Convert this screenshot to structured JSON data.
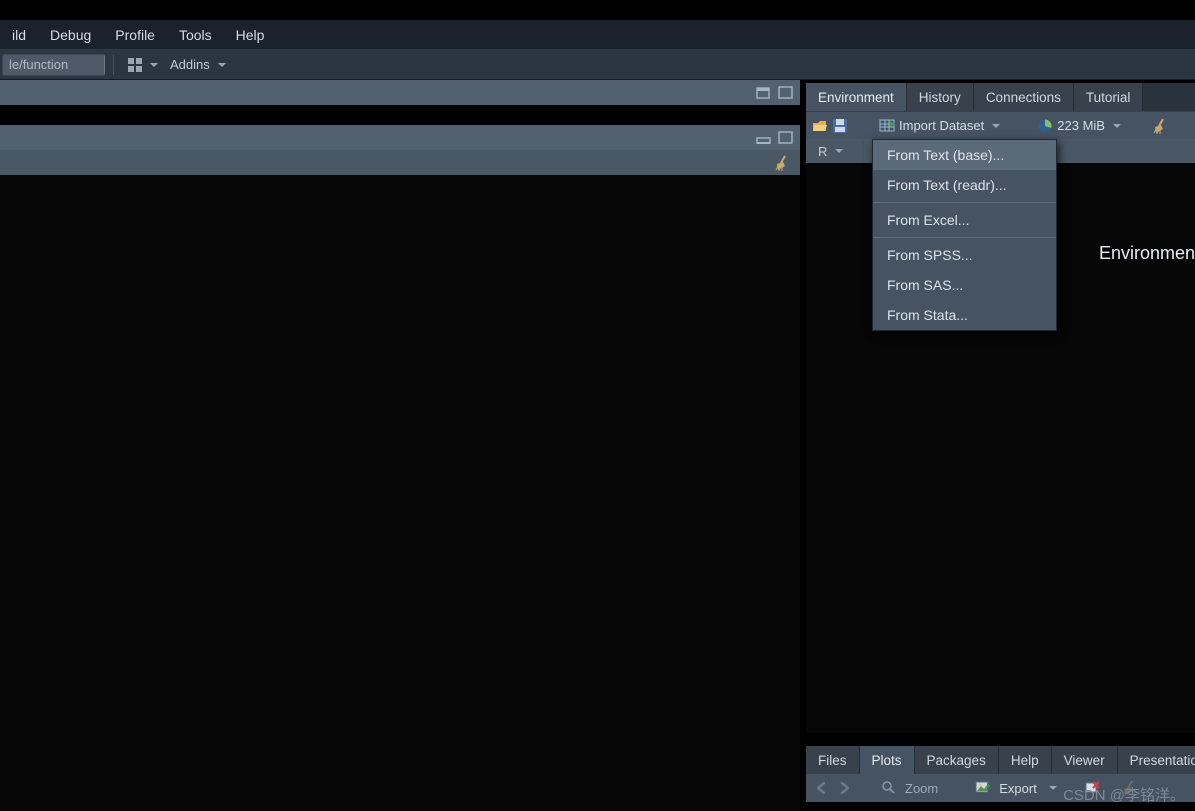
{
  "menubar": {
    "items": [
      "ild",
      "Debug",
      "Profile",
      "Tools",
      "Help"
    ]
  },
  "toolbar": {
    "goto_placeholder": "le/function",
    "addins_label": "Addins"
  },
  "right_panel": {
    "tabs": {
      "environment": "Environment",
      "history": "History",
      "connections": "Connections",
      "tutorial": "Tutorial"
    },
    "env_toolbar": {
      "import_label": "Import Dataset",
      "memory": "223 MiB"
    },
    "env_sub": {
      "scope": "R"
    },
    "dropdown_items": {
      "text_base": "From Text (base)...",
      "text_readr": "From Text (readr)...",
      "excel": "From Excel...",
      "spss": "From SPSS...",
      "sas": "From SAS...",
      "stata": "From Stata..."
    },
    "body_text": "Environmen"
  },
  "bottom_panel": {
    "tabs": {
      "files": "Files",
      "plots": "Plots",
      "packages": "Packages",
      "help": "Help",
      "viewer": "Viewer",
      "presentation": "Presentation"
    },
    "toolbar": {
      "zoom": "Zoom",
      "export": "Export"
    }
  },
  "watermark": "CSDN @李铭洋。"
}
